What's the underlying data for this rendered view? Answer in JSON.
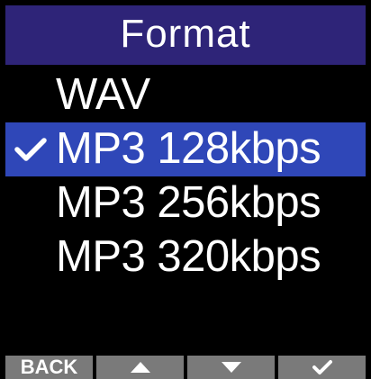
{
  "header": {
    "title": "Format"
  },
  "menu": {
    "items": [
      {
        "label": "WAV",
        "selected": false
      },
      {
        "label": "MP3 128kbps",
        "selected": true
      },
      {
        "label": "MP3 256kbps",
        "selected": false
      },
      {
        "label": "MP3 320kbps",
        "selected": false
      }
    ]
  },
  "softkeys": {
    "back_label": "BACK",
    "up_icon": "triangle-up-icon",
    "down_icon": "triangle-down-icon",
    "confirm_icon": "checkmark-icon"
  },
  "colors": {
    "title_bar": "#2e2478",
    "selection": "#2f47b8",
    "softkey": "#7a7a7a",
    "background": "#000000",
    "text": "#ffffff"
  }
}
